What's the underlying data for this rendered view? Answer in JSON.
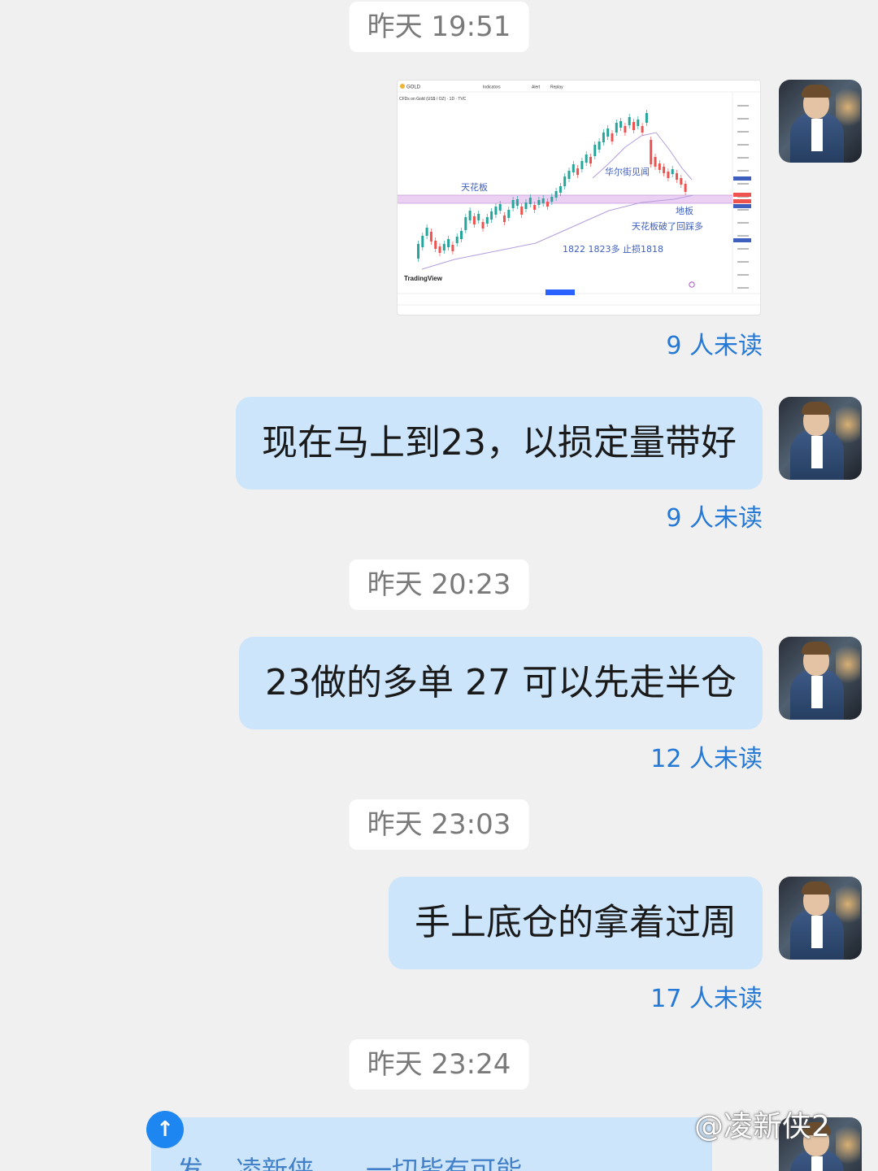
{
  "messages": [
    {
      "time": "昨天 19:51",
      "type": "image",
      "unread": "9 人未读"
    },
    {
      "type": "text",
      "text": "现在马上到23，以损定量带好",
      "unread": "9 人未读"
    },
    {
      "time": "昨天 20:23",
      "type": "text",
      "text": "23做的多单 27 可以先走半仓",
      "unread": "12 人未读"
    },
    {
      "time": "昨天 23:03",
      "type": "text",
      "text": "手上底仓的拿着过周",
      "unread": "17 人未读"
    },
    {
      "time": "昨天 23:24"
    }
  ],
  "chart_image": {
    "symbol": "GOLD",
    "toolbar": [
      "Indicators",
      "Alert",
      "Replay"
    ],
    "subtitle": "CFDs on Gold (US$ / OZ) · 1D · TVC",
    "annotations": {
      "ceiling": "天花板",
      "wall_street": "华尔街见闻",
      "floor": "地板",
      "retest": "天花板破了回踩多",
      "entry": "1822 1823多 止损1818"
    },
    "brand": "TradingView",
    "colors": {
      "up": "#26a69a",
      "down": "#ef5350",
      "zone": "#e7c8f2",
      "ma": "#b39ddb",
      "note": "#3f5fbf"
    }
  },
  "bottom": {
    "reply_icon": "reply-icon",
    "preview_parts": [
      "发",
      "凌新侠",
      "一切皆有可能"
    ]
  },
  "watermark": "@凌新侠2"
}
